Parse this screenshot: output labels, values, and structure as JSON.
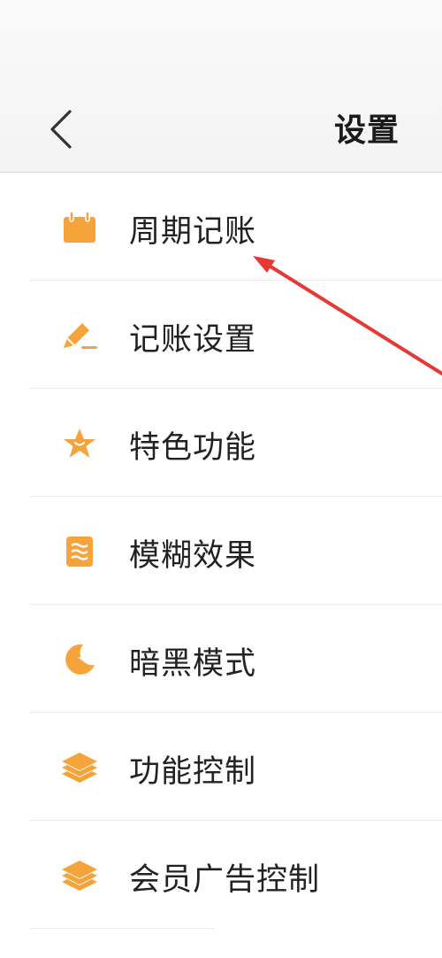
{
  "header": {
    "title": "设置",
    "back_icon": "chevron-left-icon"
  },
  "colors": {
    "accent": "#F5A33B",
    "annotation_arrow": "#E53935"
  },
  "menu": [
    {
      "id": "periodic-bookkeeping",
      "label": "周期记账",
      "icon": "calendar-icon"
    },
    {
      "id": "bookkeeping-settings",
      "label": "记账设置",
      "icon": "pencil-icon"
    },
    {
      "id": "featured-functions",
      "label": "特色功能",
      "icon": "star-icon"
    },
    {
      "id": "blur-effect",
      "label": "模糊效果",
      "icon": "blur-icon"
    },
    {
      "id": "dark-mode",
      "label": "暗黑模式",
      "icon": "moon-icon"
    },
    {
      "id": "function-control",
      "label": "功能控制",
      "icon": "layers-icon"
    },
    {
      "id": "member-ad-control",
      "label": "会员广告控制",
      "icon": "layers-icon"
    }
  ]
}
